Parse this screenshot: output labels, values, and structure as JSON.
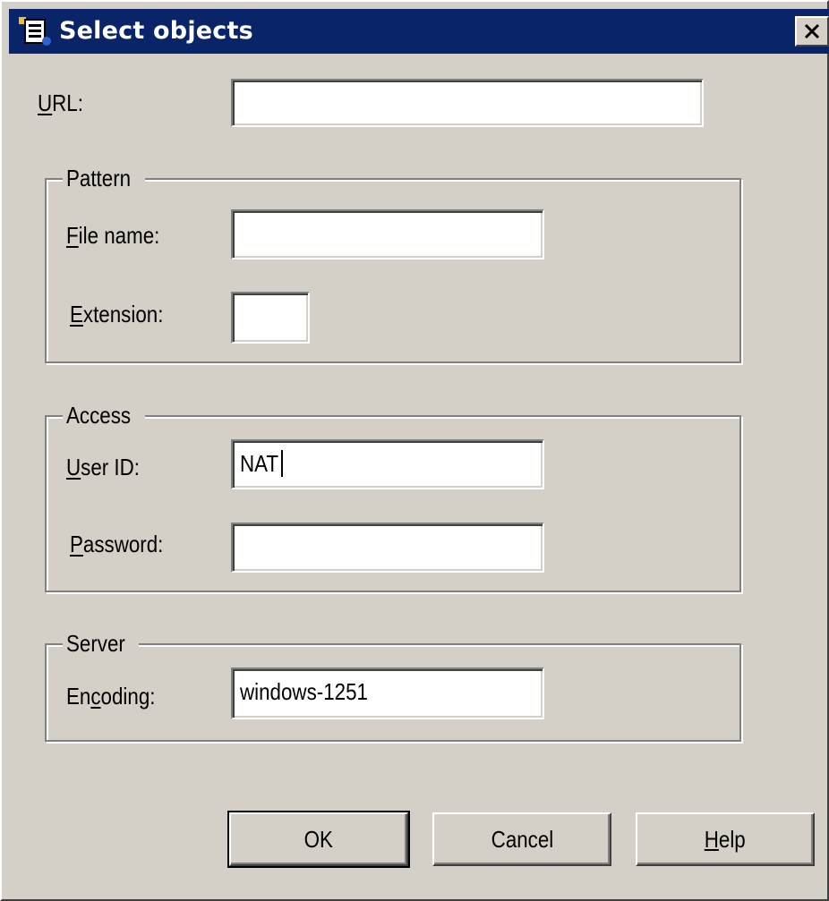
{
  "window": {
    "title": "Select objects",
    "close_glyph": "✕"
  },
  "url": {
    "label_accel": "U",
    "label_rest": "RL:",
    "value": ""
  },
  "pattern": {
    "group_title": "Pattern",
    "file_name_label_accel": "F",
    "file_name_label_rest": "ile name:",
    "file_name_value": "",
    "extension_label_accel": "E",
    "extension_label_rest": "xtension:",
    "extension_value": ""
  },
  "access": {
    "group_title": "Access",
    "user_id_label_accel": "U",
    "user_id_label_rest": "ser ID:",
    "user_id_value": "NAT",
    "password_label_accel": "P",
    "password_label_rest": "assword:",
    "password_value": ""
  },
  "server": {
    "group_title": "Server",
    "encoding_label_pre": "En",
    "encoding_label_accel": "c",
    "encoding_label_rest": "oding:",
    "encoding_value": "windows-1251"
  },
  "buttons": {
    "ok": "OK",
    "cancel": "Cancel",
    "help_accel": "H",
    "help_rest": "elp"
  },
  "colors": {
    "face": "#d4d0c8",
    "titlebar": "#0a246a"
  }
}
